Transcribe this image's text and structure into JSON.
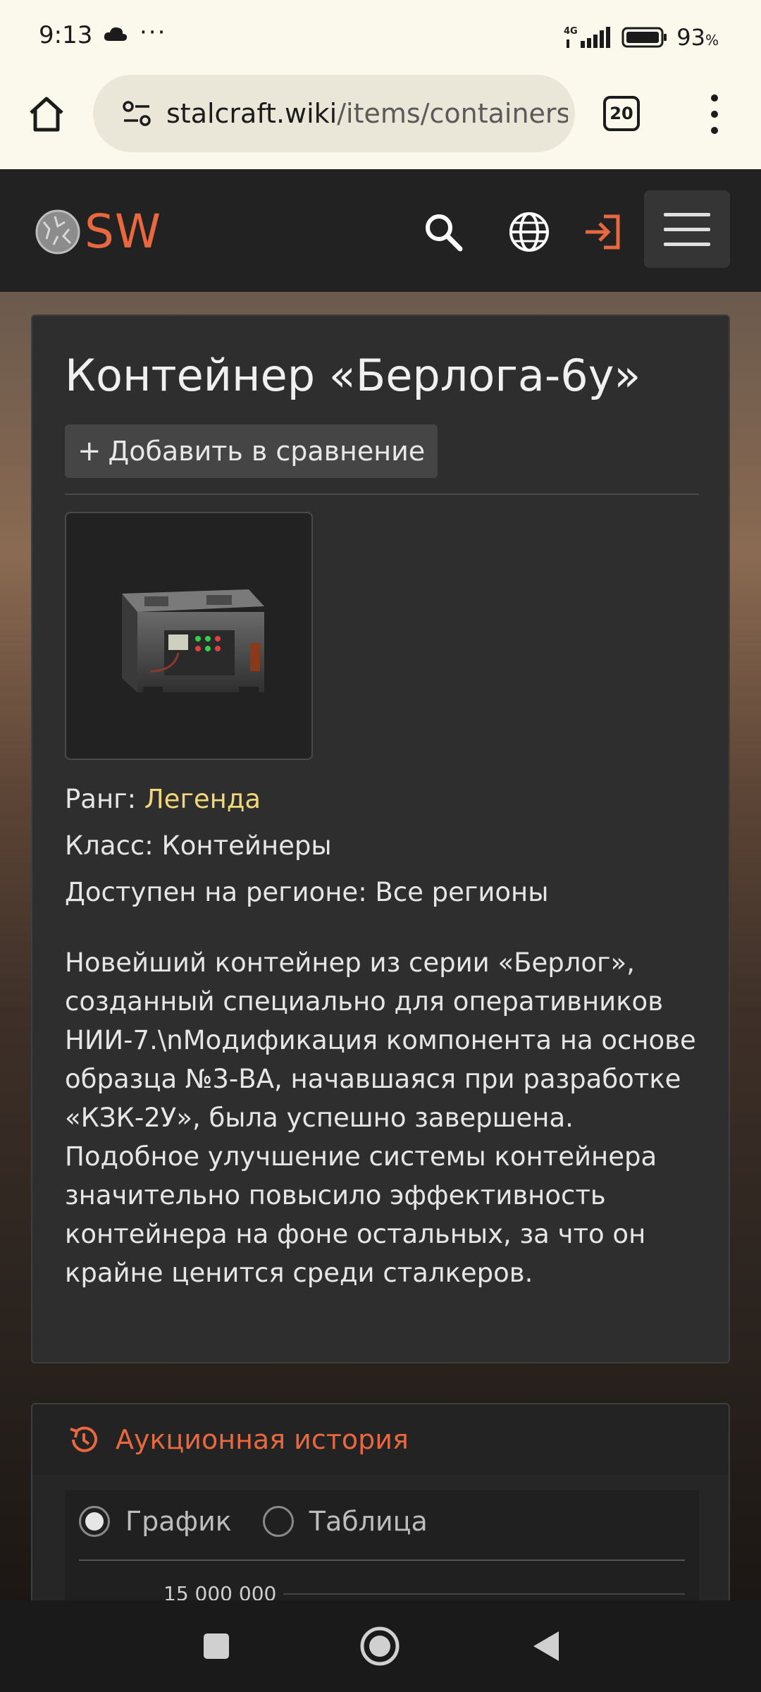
{
  "status_bar": {
    "time": "9:13",
    "more": "···",
    "network": "4G",
    "battery": "93",
    "battery_unit": "%"
  },
  "browser": {
    "url_host": "stalcraft.wiki",
    "url_path": "/items/containers",
    "tab_count": "20"
  },
  "site": {
    "logo_text": "SW",
    "accent_color": "#e9683f"
  },
  "item": {
    "title": "Контейнер «Берлога-6у»",
    "compare_plus": "+",
    "compare_label": "Добавить в сравнение",
    "rank_label": "Ранг:",
    "rank_value": "Легенда",
    "rank_color": "#f2d779",
    "class_label": "Класс: Контейнеры",
    "region_label": "Доступен на регионе: Все регионы",
    "description": "Новейший контейнер из серии «Берлог», созданный специально для оперативников НИИ-7.\\nМодификация компонента на основе образца №3-ВА, начавшаяся при разработке «КЗК-2У», была успешно завершена. Подобное улучшение системы контейнера значительно повысило эффективность контейнера на фоне остальных, за что он крайне ценится среди сталкеров."
  },
  "auction": {
    "title": "Аукционная история",
    "option_chart": "График",
    "option_table": "Таблица",
    "selected": "График",
    "axis_top": "15 000 000"
  }
}
